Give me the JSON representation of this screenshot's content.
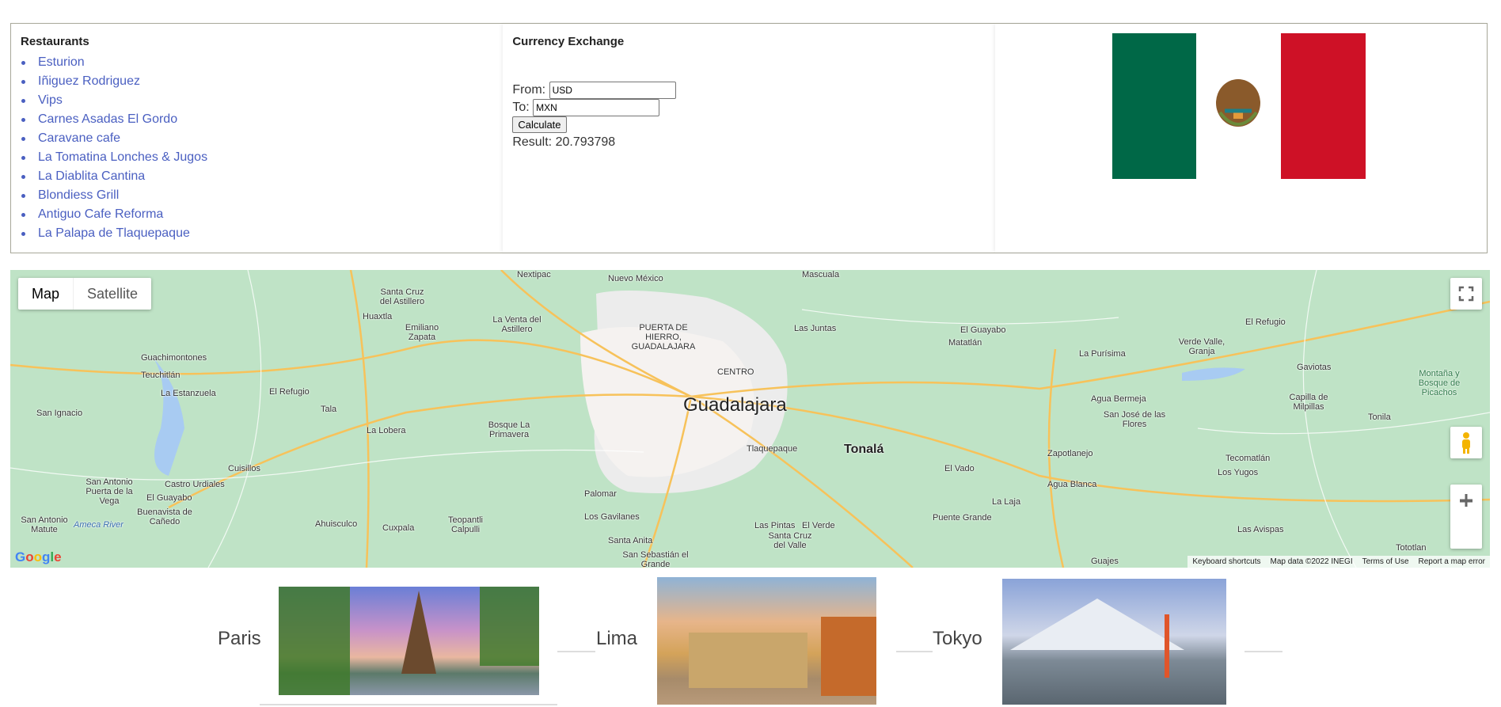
{
  "restaurants": {
    "title": "Restaurants",
    "items": [
      "Esturion",
      "Iñiguez Rodriguez",
      "Vips",
      "Carnes Asadas El Gordo",
      "Caravane cafe",
      "La Tomatina Lonches & Jugos",
      "La Diablita Cantina",
      "Blondiess Grill",
      "Antiguo Cafe Reforma",
      "La Palapa de Tlaquepaque"
    ]
  },
  "currency": {
    "title": "Currency Exchange",
    "from_label": "From:",
    "from_value": "USD",
    "to_label": "To:",
    "to_value": "MXN",
    "button": "Calculate",
    "result": "Result: 20.793798"
  },
  "flag": {
    "colors": [
      "#006847",
      "#ffffff",
      "#ce1126"
    ]
  },
  "map": {
    "type_map": "Map",
    "type_satellite": "Satellite",
    "logo": "Google",
    "footer": [
      "Keyboard shortcuts",
      "Map data ©2022 INEGI",
      "Terms of Use",
      "Report a map error"
    ],
    "labels": {
      "gdl": "Guadalajara",
      "tonala": "Tonalá",
      "centro": "CENTRO",
      "puerta": "PUERTA DE HIERRO, GUADALAJARA",
      "tlaq": "Tlaquepaque",
      "nextipac": "Nextipac",
      "nuevomex": "Nuevo México",
      "mascuala": "Mascuala",
      "santacruz": "Santa Cruz del Astillero",
      "huaxtla": "Huaxtla",
      "emiliano": "Emiliano Zapata",
      "laventa": "La Venta del Astillero",
      "lasjuntas": "Las Juntas",
      "guachi": "Guachimontones",
      "teuchi": "Teuchitlán",
      "estanzuela": "La Estanzuela",
      "refugio": "El Refugio",
      "tala": "Tala",
      "sanignacio": "San Ignacio",
      "lalobera": "La Lobera",
      "bosque": "Bosque La Primavera",
      "cuisillos": "Cuisillos",
      "castro": "Castro Urdiales",
      "guayabo": "El Guayabo",
      "sanantonio": "San Antonio Puerta de la Vega",
      "buenavista": "Buenavista de Cañedo",
      "matute": "San Antonio Matute",
      "ameca": "Ameca River",
      "ahuisculco": "Ahuisculco",
      "cuxpala": "Cuxpala",
      "teopanti": "Teopantli Calpulli",
      "palomar": "Palomar",
      "gavilanes": "Los Gavilanes",
      "santaanita": "Santa Anita",
      "sansebastian": "San Sebastián el Grande",
      "laspintas": "Las Pintas",
      "elverde": "El Verde",
      "santacruzvalle": "Santa Cruz del Valle",
      "elguayabo2": "El Guayabo",
      "matatlan": "Matatlán",
      "lapurisima": "La Purísima",
      "verdevalle": "Verde Valle, Granja",
      "elrefugio2": "El Refugio",
      "gaviotas": "Gaviotas",
      "aguabermeja": "Agua Bermeja",
      "sanjose": "San José de las Flores",
      "capilla": "Capilla de Milpillas",
      "tonila": "Tonila",
      "montana": "Montaña y Bosque de Picachos",
      "zapotlanejo": "Zapotlanejo",
      "tecomatlan": "Tecomatlán",
      "losyugos": "Los Yugos",
      "elvado": "El Vado",
      "aguablanca": "Agua Blanca",
      "lalaja": "La Laja",
      "puentegrande": "Puente Grande",
      "lasavispas": "Las Avispas",
      "tototlan": "Tototlan",
      "guajes": "Guajes"
    }
  },
  "destinations": [
    {
      "name": "Paris"
    },
    {
      "name": "Lima"
    },
    {
      "name": "Tokyo"
    }
  ]
}
